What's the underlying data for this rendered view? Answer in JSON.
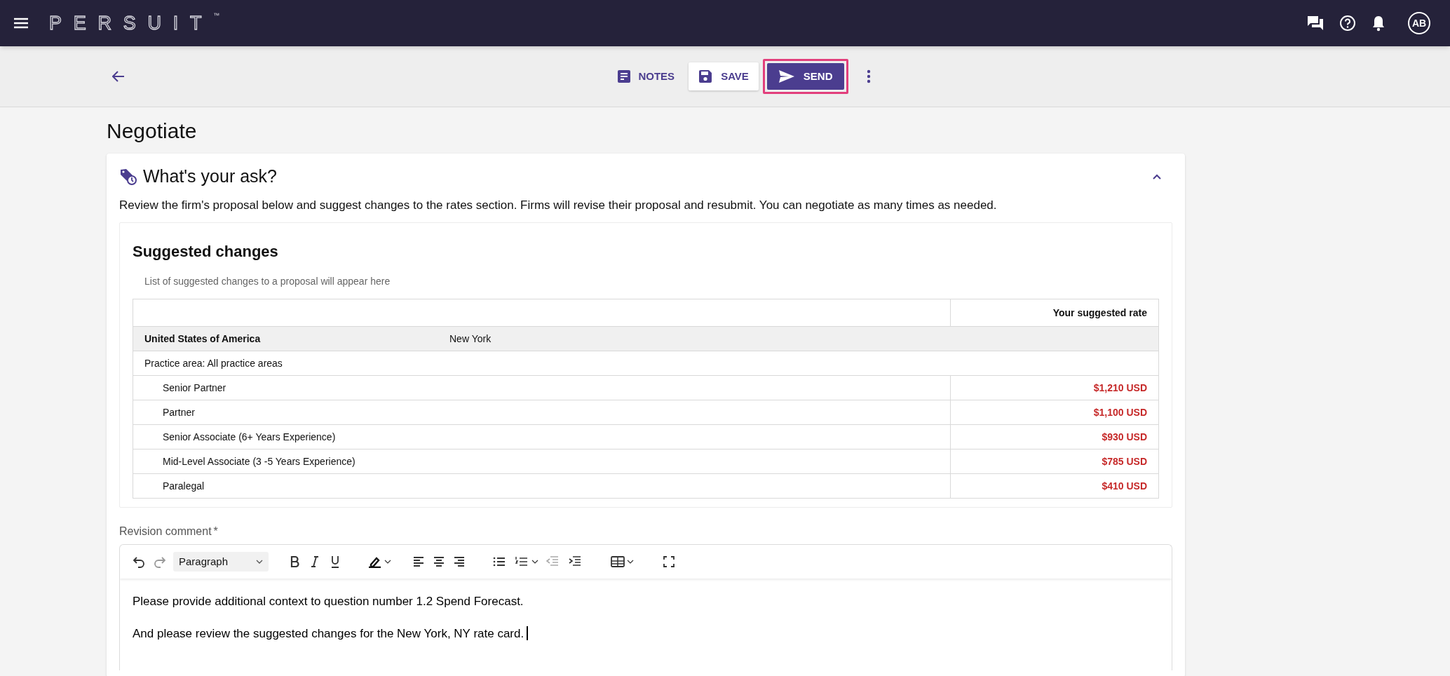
{
  "top_bar": {
    "logo": "PERSUIT",
    "trademark": "™",
    "avatar": "AB"
  },
  "action_bar": {
    "buttons": [
      {
        "label": "NOTES",
        "kind": "text",
        "highlighted": false
      },
      {
        "label": "SAVE",
        "kind": "outlined",
        "highlighted": false
      },
      {
        "label": "SEND",
        "kind": "primary",
        "highlighted": true
      }
    ]
  },
  "page_title": "Negotiate",
  "section": {
    "title": "What's your ask?",
    "expanded": true,
    "description": "Review the firm's proposal below and suggest changes to the rates section. Firms will revise their proposal and resubmit. You can negotiate as many times as needed.",
    "suggested_changes": {
      "title": "Suggested changes",
      "subtitle": "List of suggested changes to a proposal will appear here",
      "rate_column_header": "Your suggested rate",
      "groups": [
        {
          "country": "United States of America",
          "city": "New York",
          "practice_area": "Practice area: All practice areas",
          "rows": [
            {
              "role": "Senior Partner",
              "rate": "$1,210 USD"
            },
            {
              "role": "Partner",
              "rate": "$1,100 USD"
            },
            {
              "role": "Senior Associate (6+ Years Experience)",
              "rate": "$930 USD"
            },
            {
              "role": "Mid-Level Associate (3 -5 Years Experience)",
              "rate": "$785 USD"
            },
            {
              "role": "Paralegal",
              "rate": "$410 USD"
            }
          ]
        }
      ]
    },
    "revision_comment": {
      "label": "Revision comment",
      "required_mark": "*",
      "block_style": "Paragraph",
      "paragraphs": [
        "Please provide additional context to question number 1.2 Spend Forecast.",
        "And please review the suggested changes for the New York, NY rate card."
      ]
    }
  }
}
